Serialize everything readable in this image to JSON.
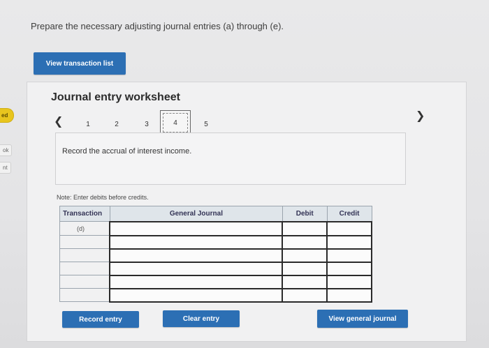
{
  "side_tabs": [
    "ed",
    "ok",
    "nt"
  ],
  "prompt": "Prepare the necessary adjusting journal entries (a) through (e).",
  "buttons": {
    "view_transactions": "View transaction list",
    "record_entry": "Record entry",
    "clear_entry": "Clear entry",
    "view_general_journal": "View general journal"
  },
  "worksheet": {
    "title": "Journal entry worksheet",
    "steps": [
      "1",
      "2",
      "3",
      "4",
      "5"
    ],
    "active_step": "4",
    "instruction": "Record the accrual of interest income.",
    "note": "Note: Enter debits before credits."
  },
  "journal": {
    "headers": [
      "Transaction",
      "General Journal",
      "Debit",
      "Credit"
    ],
    "rows": [
      {
        "transaction": "(d)",
        "account": "",
        "debit": "",
        "credit": ""
      },
      {
        "transaction": "",
        "account": "",
        "debit": "",
        "credit": ""
      },
      {
        "transaction": "",
        "account": "",
        "debit": "",
        "credit": ""
      },
      {
        "transaction": "",
        "account": "",
        "debit": "",
        "credit": ""
      },
      {
        "transaction": "",
        "account": "",
        "debit": "",
        "credit": ""
      },
      {
        "transaction": "",
        "account": "",
        "debit": "",
        "credit": ""
      }
    ]
  },
  "icons": {
    "prev": "chevron-left-icon",
    "next": "chevron-right-icon"
  },
  "colors": {
    "button": "#2c6fb4",
    "active_badge": "#e8c51e"
  }
}
